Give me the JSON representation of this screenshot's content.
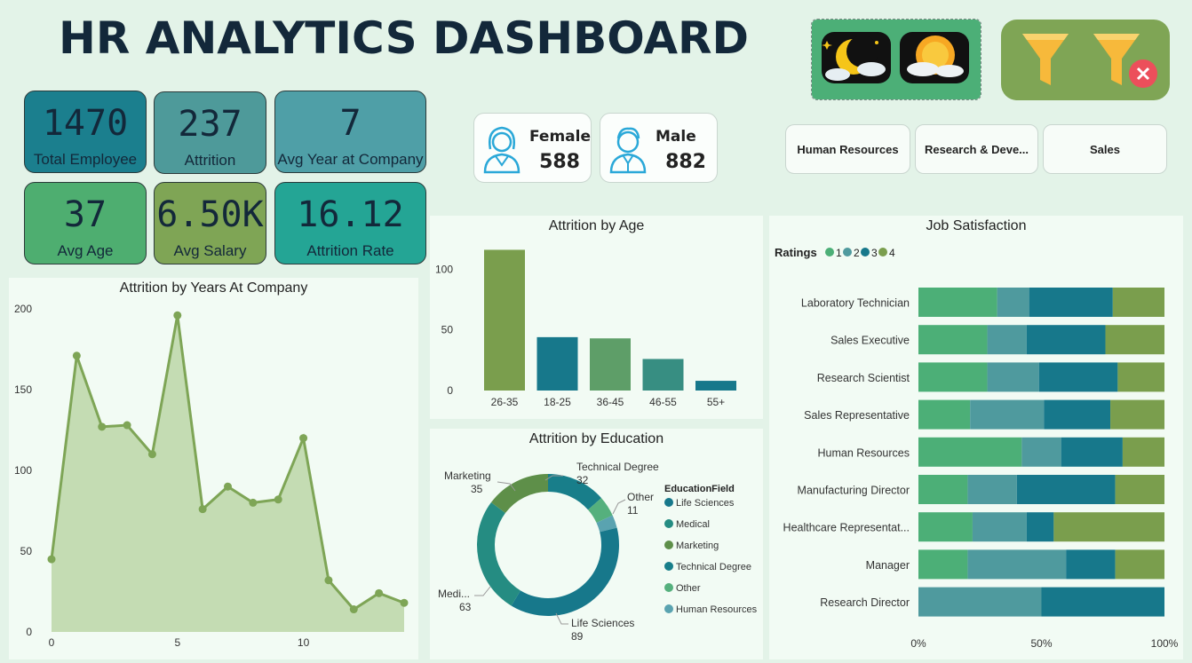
{
  "header": {
    "title": "HR ANALYTICS DASHBOARD"
  },
  "kpis": {
    "total_employee": {
      "value": "1470",
      "label": "Total Employee"
    },
    "attrition": {
      "value": "237",
      "label": "Attrition"
    },
    "avg_year": {
      "value": "7",
      "label": "Avg Year at Company"
    },
    "avg_age": {
      "value": "37",
      "label": "Avg Age"
    },
    "avg_salary": {
      "value": "6.50K",
      "label": "Avg Salary"
    },
    "attrition_rate": {
      "value": "16.12",
      "label": "Attrition Rate"
    }
  },
  "gender": {
    "female": {
      "label": "Female",
      "value": "588"
    },
    "male": {
      "label": "Male",
      "value": "882"
    }
  },
  "department_slicer": [
    "Human Resources",
    "Research & Deve...",
    "Sales"
  ],
  "toolbar_icons": [
    "night-mode-icon",
    "day-mode-icon",
    "filter-icon",
    "clear-filter-icon"
  ],
  "colors": {
    "green": "#4caf77",
    "teal_light": "#4f9a9e",
    "teal": "#17788b",
    "olive": "#7a9e4d",
    "area": "#7ea556"
  },
  "chart_data": [
    {
      "id": "years",
      "type": "area",
      "title": "Attrition by Years At Company",
      "x": [
        0,
        1,
        2,
        3,
        4,
        5,
        6,
        7,
        8,
        9,
        10,
        11,
        12,
        13,
        14
      ],
      "values": [
        45,
        171,
        127,
        128,
        110,
        196,
        76,
        90,
        80,
        82,
        120,
        32,
        14,
        24,
        18
      ],
      "xticks": [
        "0",
        "5",
        "10"
      ],
      "yticks": [
        "0",
        "50",
        "100",
        "150",
        "200"
      ],
      "ylim": [
        0,
        200
      ]
    },
    {
      "id": "age",
      "type": "bar",
      "title": "Attrition by Age",
      "categories": [
        "26-35",
        "18-25",
        "36-45",
        "46-55",
        "55+"
      ],
      "values": [
        116,
        44,
        43,
        26,
        8
      ],
      "yticks": [
        "0",
        "50",
        "100"
      ],
      "ylim": [
        0,
        120
      ]
    },
    {
      "id": "education",
      "type": "pie",
      "title": "Attrition by Education",
      "legend_title": "EducationField",
      "labels": [
        "Life Sciences",
        "Medical",
        "Marketing",
        "Technical Degree",
        "Other",
        "Human Resources"
      ],
      "values": [
        89,
        63,
        35,
        32,
        11,
        7
      ],
      "label_texts": [
        {
          "name": "Life Sciences",
          "value": "89"
        },
        {
          "name": "Medi...",
          "value": "63"
        },
        {
          "name": "Marketing",
          "value": "35"
        },
        {
          "name": "Technical Degree",
          "value": "32"
        },
        {
          "name": "Other",
          "value": "11"
        }
      ]
    },
    {
      "id": "jobsat",
      "type": "bar",
      "stacked": "100%",
      "orientation": "horizontal",
      "title": "Job Satisfaction",
      "legend_title": "Ratings",
      "categories": [
        "Laboratory Technician",
        "Sales Executive",
        "Research Scientist",
        "Sales Representative",
        "Human Resources",
        "Manufacturing Director",
        "Healthcare Representat...",
        "Manager",
        "Research Director"
      ],
      "series": [
        {
          "name": "1",
          "values": [
            32,
            28,
            28,
            21,
            42,
            20,
            22,
            20,
            0
          ]
        },
        {
          "name": "2",
          "values": [
            13,
            16,
            21,
            30,
            16,
            20,
            22,
            40,
            50
          ]
        },
        {
          "name": "3",
          "values": [
            34,
            32,
            32,
            27,
            25,
            40,
            11,
            20,
            50
          ]
        },
        {
          "name": "4",
          "values": [
            21,
            24,
            19,
            22,
            17,
            20,
            45,
            20,
            0
          ]
        }
      ],
      "xticks": [
        "0%",
        "50%",
        "100%"
      ]
    }
  ]
}
